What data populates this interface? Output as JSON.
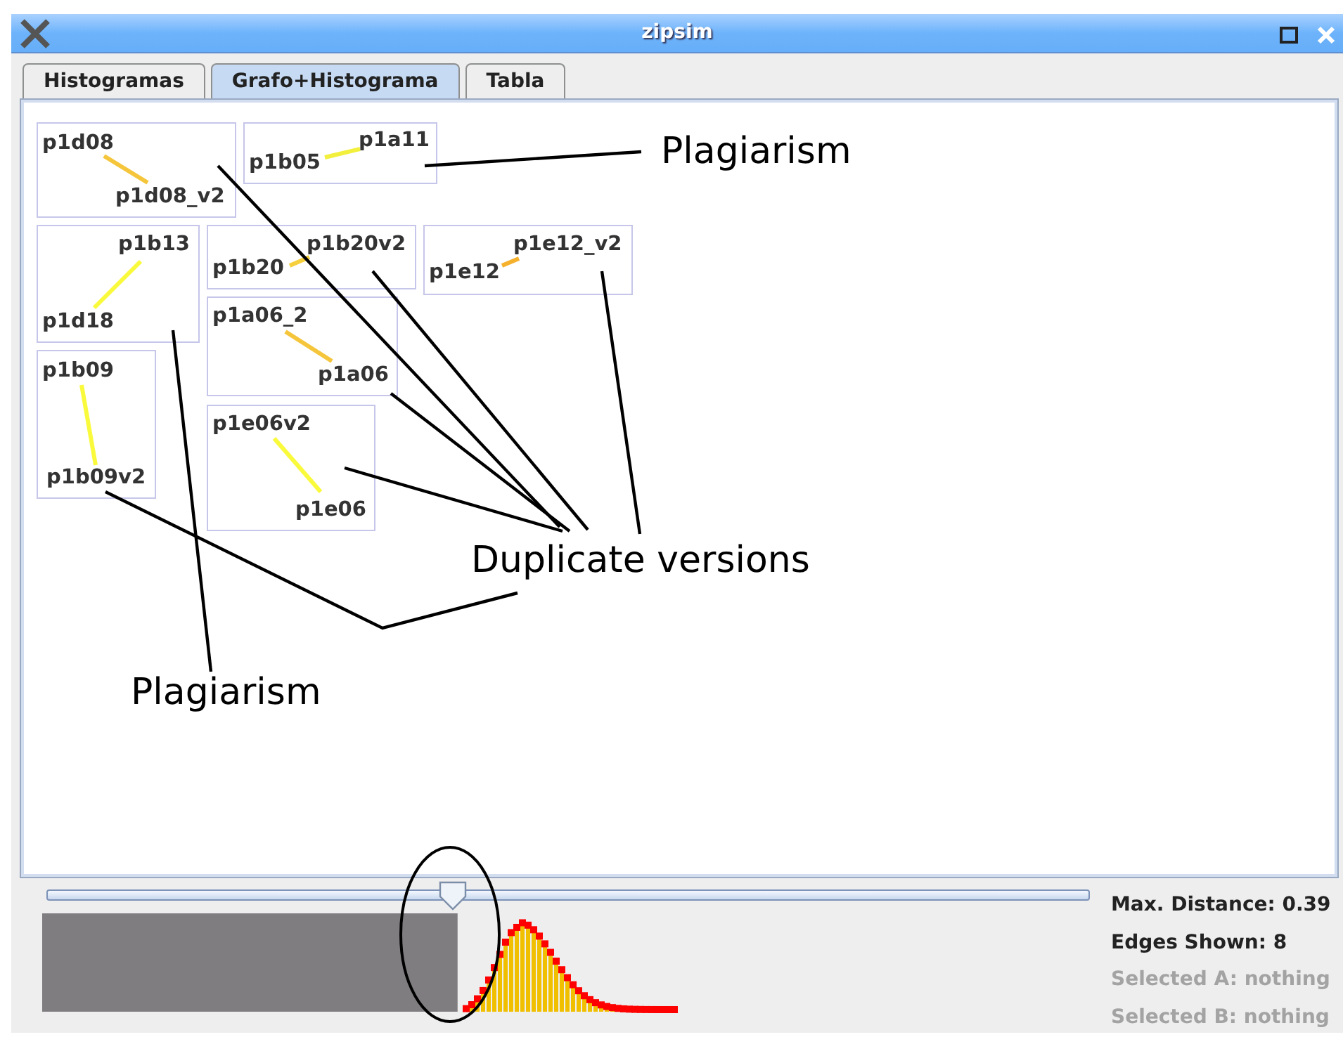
{
  "window": {
    "title": "zipsim"
  },
  "tabs": [
    {
      "label": "Histogramas",
      "selected": false
    },
    {
      "label": "Grafo+Histograma",
      "selected": true
    },
    {
      "label": "Tabla",
      "selected": false
    }
  ],
  "graph": {
    "clusters": [
      {
        "nodes": [
          "p1d08",
          "p1d08_v2"
        ],
        "color": "#f5c63c"
      },
      {
        "nodes": [
          "p1b05",
          "p1a11"
        ],
        "color": "#f2f03c"
      },
      {
        "nodes": [
          "p1b13",
          "p1d18"
        ],
        "color": "#fafa3c"
      },
      {
        "nodes": [
          "p1b20",
          "p1b20v2"
        ],
        "color": "#f5d03c"
      },
      {
        "nodes": [
          "p1e12",
          "p1e12_v2"
        ],
        "color": "#f5b02c"
      },
      {
        "nodes": [
          "p1a06_2",
          "p1a06"
        ],
        "color": "#f5c63c"
      },
      {
        "nodes": [
          "p1b09",
          "p1b09v2"
        ],
        "color": "#fafa3c"
      },
      {
        "nodes": [
          "p1e06v2",
          "p1e06"
        ],
        "color": "#fafa3c"
      }
    ]
  },
  "annotations": [
    {
      "text": "Plagiarism"
    },
    {
      "text": "Duplicate versions"
    },
    {
      "text": "Plagiarism"
    }
  ],
  "slider": {
    "level": 0.39
  },
  "info": [
    {
      "text": "Max. Distance: 0.39",
      "disabled": false
    },
    {
      "text": "Edges Shown: 8",
      "disabled": false
    },
    {
      "text": "Selected A: nothing",
      "disabled": true
    },
    {
      "text": "Selected B: nothing",
      "disabled": true
    }
  ]
}
